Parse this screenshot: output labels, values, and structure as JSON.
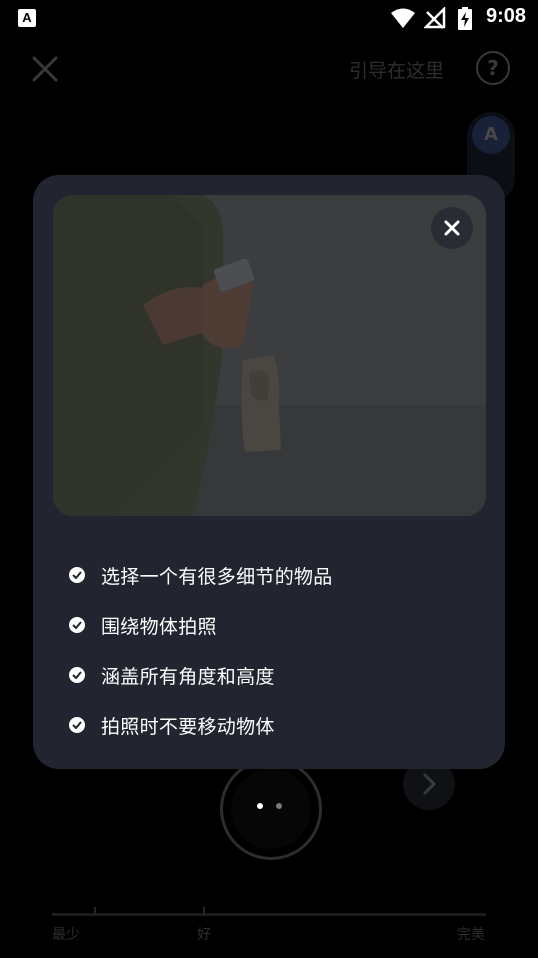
{
  "status_bar": {
    "app_badge": "A",
    "time": "9:08"
  },
  "top_bar": {
    "title": "引导在这里",
    "help_label": "?"
  },
  "mode_selector": {
    "selected": "A"
  },
  "quality_scale": {
    "labels": [
      "最少",
      "好",
      "完美"
    ]
  },
  "modal": {
    "tips": [
      "选择一个有很多细节的物品",
      "围绕物体拍照",
      "涵盖所有角度和高度",
      "拍照时不要移动物体"
    ]
  },
  "pager": {
    "page_count": 2,
    "current": 1
  },
  "colors": {
    "modal_bg": "#222530",
    "accent_blue": "#5677c4"
  }
}
